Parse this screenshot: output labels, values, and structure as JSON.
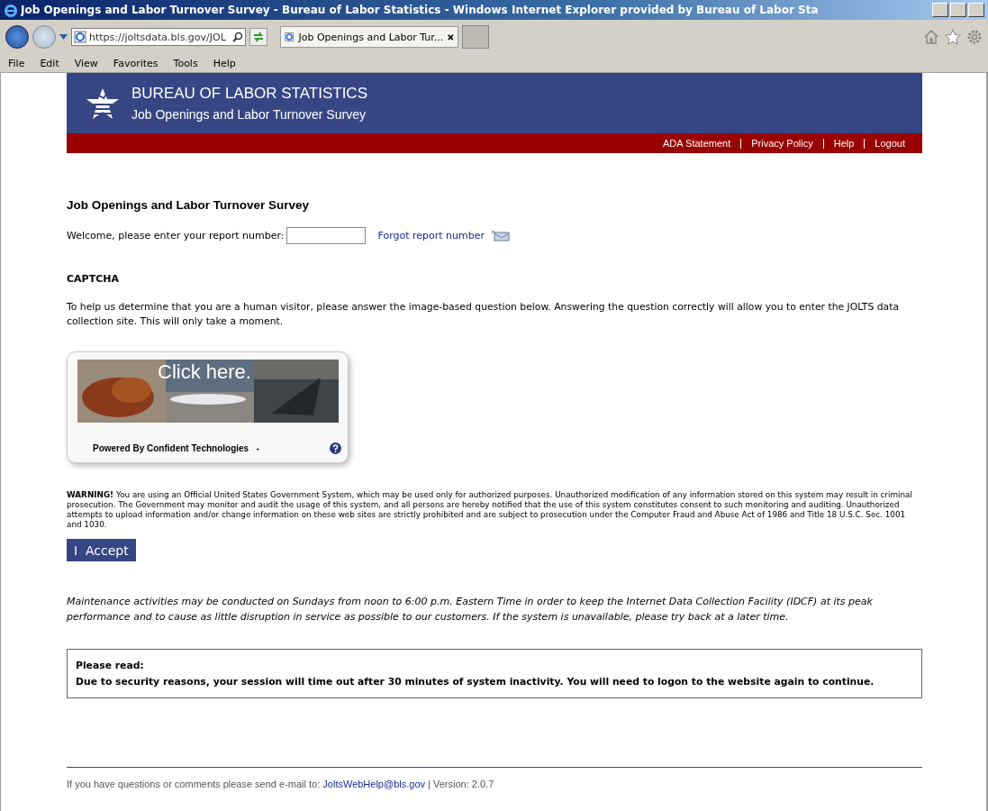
{
  "window": {
    "title": "Job Openings and Labor Turnover Survey - Bureau of Labor Statistics - Windows Internet Explorer provided by Bureau of Labor Sta"
  },
  "address_bar": {
    "value": "https://joltsdata.bls.gov/JOL"
  },
  "tabs": [
    {
      "label": "Job Openings and Labor Tur...",
      "selected": true
    }
  ],
  "menu": [
    "File",
    "Edit",
    "View",
    "Favorites",
    "Tools",
    "Help"
  ],
  "header": {
    "title": "BUREAU OF LABOR STATISTICS",
    "subtitle": "Job Openings and Labor Turnover Survey"
  },
  "top_links": [
    "ADA Statement",
    "Privacy Policy",
    "Help",
    "Logout"
  ],
  "page_title": "Job Openings and Labor Turnover Survey",
  "report_number": {
    "label": "Welcome, please enter your report number:",
    "link": "Forgot report number"
  },
  "captcha": {
    "heading": "CAPTCHA",
    "instructions": "To help us determine that you are a human visitor, please answer the image-based question below. Answering the question correctly will allow you to enter the JOLTS data collection site. This will only take a moment.",
    "prompt": "Click here.",
    "powered_by": "Powered By Confident Technologies   -"
  },
  "warning": "**WARNING!** You are using an Official United States Government System, which may be used only for authorized purposes. Unauthorized modification of any information stored on this system may result in criminal prosecution. The Government may monitor and audit the usage of this system, and all persons are hereby notified that the use of this system constitutes consent to such monitoring and auditing. Unauthorized attempts to upload information and/or change information on these web sites are strictly prohibited and are subject to prosecution under the Computer Fraud and Abuse Act of 1986 and Title 18 U.S.C. Sec. 1001 and 1030.",
  "accept_button": "I  Accept",
  "maintenance": "Maintenance activities may be conducted on Sundays from noon to 6:00 p.m. Eastern Time in order to keep the Internet Data Collection Facility (IDCF) at its peak performance and to cause as little disruption in service as possible to our customers. If the system is unavailable, please try back at a later time.",
  "notice": {
    "heading": "Please read:",
    "text": "Due to security reasons, your session will time out after 30 minutes of system inactivity. You will need to logon to the website again to continue."
  },
  "footer": {
    "text": "If you have questions or comments please send e-mail to: ",
    "email": "JoltsWebHelp@bls.gov",
    "version": " | Version: 2.0.7"
  }
}
